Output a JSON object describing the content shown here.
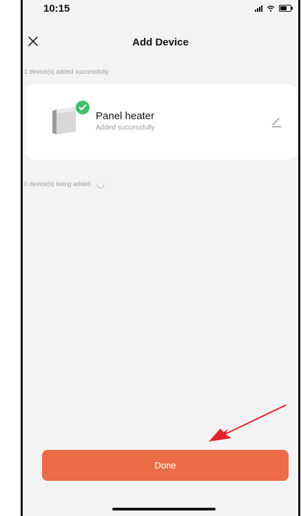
{
  "status_bar": {
    "time": "10:15"
  },
  "nav": {
    "title": "Add Device",
    "close_icon": "close-icon"
  },
  "added_section": {
    "label": "1 device(s) added successfully",
    "devices": [
      {
        "name": "Panel heater",
        "status": "Added successfully",
        "icon": "panel-heater-icon",
        "badge_icon": "check-icon",
        "action_icon": "edit-icon"
      }
    ]
  },
  "adding_section": {
    "label": "0 device(s) being added",
    "icon": "loading-spinner-icon"
  },
  "footer": {
    "done_label": "Done"
  },
  "colors": {
    "accent": "#ec6d45",
    "success": "#3fbf6a",
    "annotation_arrow": "#e3242b",
    "background": "#f3f3f5"
  }
}
